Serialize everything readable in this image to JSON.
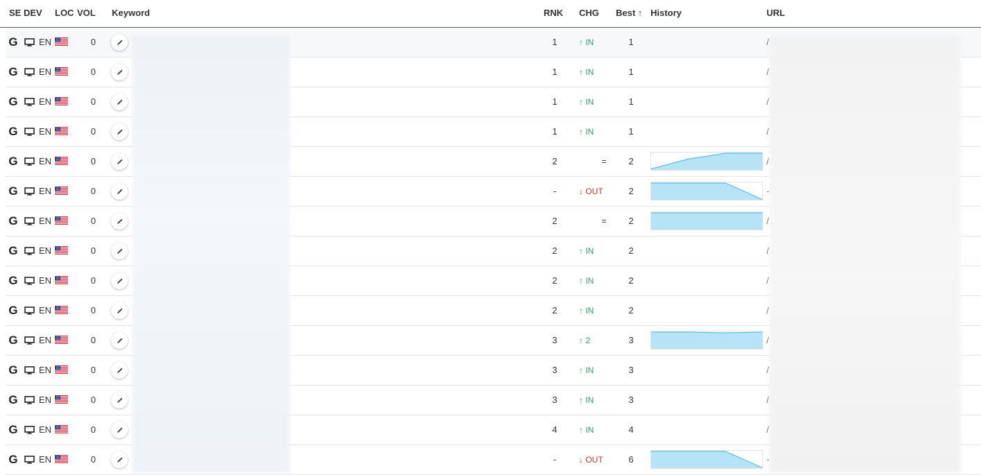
{
  "header": {
    "se": "SE",
    "dev": "DEV",
    "loc": "LOC",
    "vol": "VOL",
    "keyword": "Keyword",
    "rnk": "RNK",
    "chg": "CHG",
    "best": "Best ↑",
    "history": "History",
    "url": "URL"
  },
  "colors": {
    "up": "#2e9e64",
    "down": "#c0392b",
    "history_fill": "#b6e3f6",
    "history_line": "#5bbde4"
  },
  "rows": [
    {
      "engine": "G",
      "device": "desktop-icon",
      "lang": "EN",
      "country": "us-flag",
      "vol": "0",
      "rank": "1",
      "chg": "IN",
      "dir": "up",
      "best": "1",
      "url": "/",
      "history": []
    },
    {
      "engine": "G",
      "device": "desktop-icon",
      "lang": "EN",
      "country": "us-flag",
      "vol": "0",
      "rank": "1",
      "chg": "IN",
      "dir": "up",
      "best": "1",
      "url": "/",
      "history": []
    },
    {
      "engine": "G",
      "device": "desktop-icon",
      "lang": "EN",
      "country": "us-flag",
      "vol": "0",
      "rank": "1",
      "chg": "IN",
      "dir": "up",
      "best": "1",
      "url": "/",
      "history": []
    },
    {
      "engine": "G",
      "device": "desktop-icon",
      "lang": "EN",
      "country": "us-flag",
      "vol": "0",
      "rank": "1",
      "chg": "IN",
      "dir": "up",
      "best": "1",
      "url": "/",
      "history": []
    },
    {
      "engine": "G",
      "device": "desktop-icon",
      "lang": "EN",
      "country": "us-flag",
      "vol": "0",
      "rank": "2",
      "chg": "=",
      "dir": "eq",
      "best": "2",
      "url": "/",
      "history": [
        0.05,
        0.65,
        1,
        1
      ]
    },
    {
      "engine": "G",
      "device": "desktop-icon",
      "lang": "EN",
      "country": "us-flag",
      "vol": "0",
      "rank": "-",
      "chg": "OUT",
      "dir": "down",
      "best": "2",
      "url": "-",
      "history": [
        1,
        1,
        1,
        0
      ]
    },
    {
      "engine": "G",
      "device": "desktop-icon",
      "lang": "EN",
      "country": "us-flag",
      "vol": "0",
      "rank": "2",
      "chg": "=",
      "dir": "eq",
      "best": "2",
      "url": "/",
      "history": [
        1,
        1,
        1,
        1
      ]
    },
    {
      "engine": "G",
      "device": "desktop-icon",
      "lang": "EN",
      "country": "us-flag",
      "vol": "0",
      "rank": "2",
      "chg": "IN",
      "dir": "up",
      "best": "2",
      "url": "/",
      "history": []
    },
    {
      "engine": "G",
      "device": "desktop-icon",
      "lang": "EN",
      "country": "us-flag",
      "vol": "0",
      "rank": "2",
      "chg": "IN",
      "dir": "up",
      "best": "2",
      "url": "/",
      "history": []
    },
    {
      "engine": "G",
      "device": "desktop-icon",
      "lang": "EN",
      "country": "us-flag",
      "vol": "0",
      "rank": "2",
      "chg": "IN",
      "dir": "up",
      "best": "2",
      "url": "/",
      "history": []
    },
    {
      "engine": "G",
      "device": "desktop-icon",
      "lang": "EN",
      "country": "us-flag",
      "vol": "0",
      "rank": "3",
      "chg": "2",
      "dir": "up",
      "best": "3",
      "url": "/",
      "history": [
        1,
        1,
        0.96,
        1
      ]
    },
    {
      "engine": "G",
      "device": "desktop-icon",
      "lang": "EN",
      "country": "us-flag",
      "vol": "0",
      "rank": "3",
      "chg": "IN",
      "dir": "up",
      "best": "3",
      "url": "/",
      "history": []
    },
    {
      "engine": "G",
      "device": "desktop-icon",
      "lang": "EN",
      "country": "us-flag",
      "vol": "0",
      "rank": "3",
      "chg": "IN",
      "dir": "up",
      "best": "3",
      "url": "/",
      "history": []
    },
    {
      "engine": "G",
      "device": "desktop-icon",
      "lang": "EN",
      "country": "us-flag",
      "vol": "0",
      "rank": "4",
      "chg": "IN",
      "dir": "up",
      "best": "4",
      "url": "/",
      "history": []
    },
    {
      "engine": "G",
      "device": "desktop-icon",
      "lang": "EN",
      "country": "us-flag",
      "vol": "0",
      "rank": "-",
      "chg": "OUT",
      "dir": "down",
      "best": "6",
      "url": "-",
      "history": [
        1,
        1,
        1,
        0
      ]
    }
  ]
}
